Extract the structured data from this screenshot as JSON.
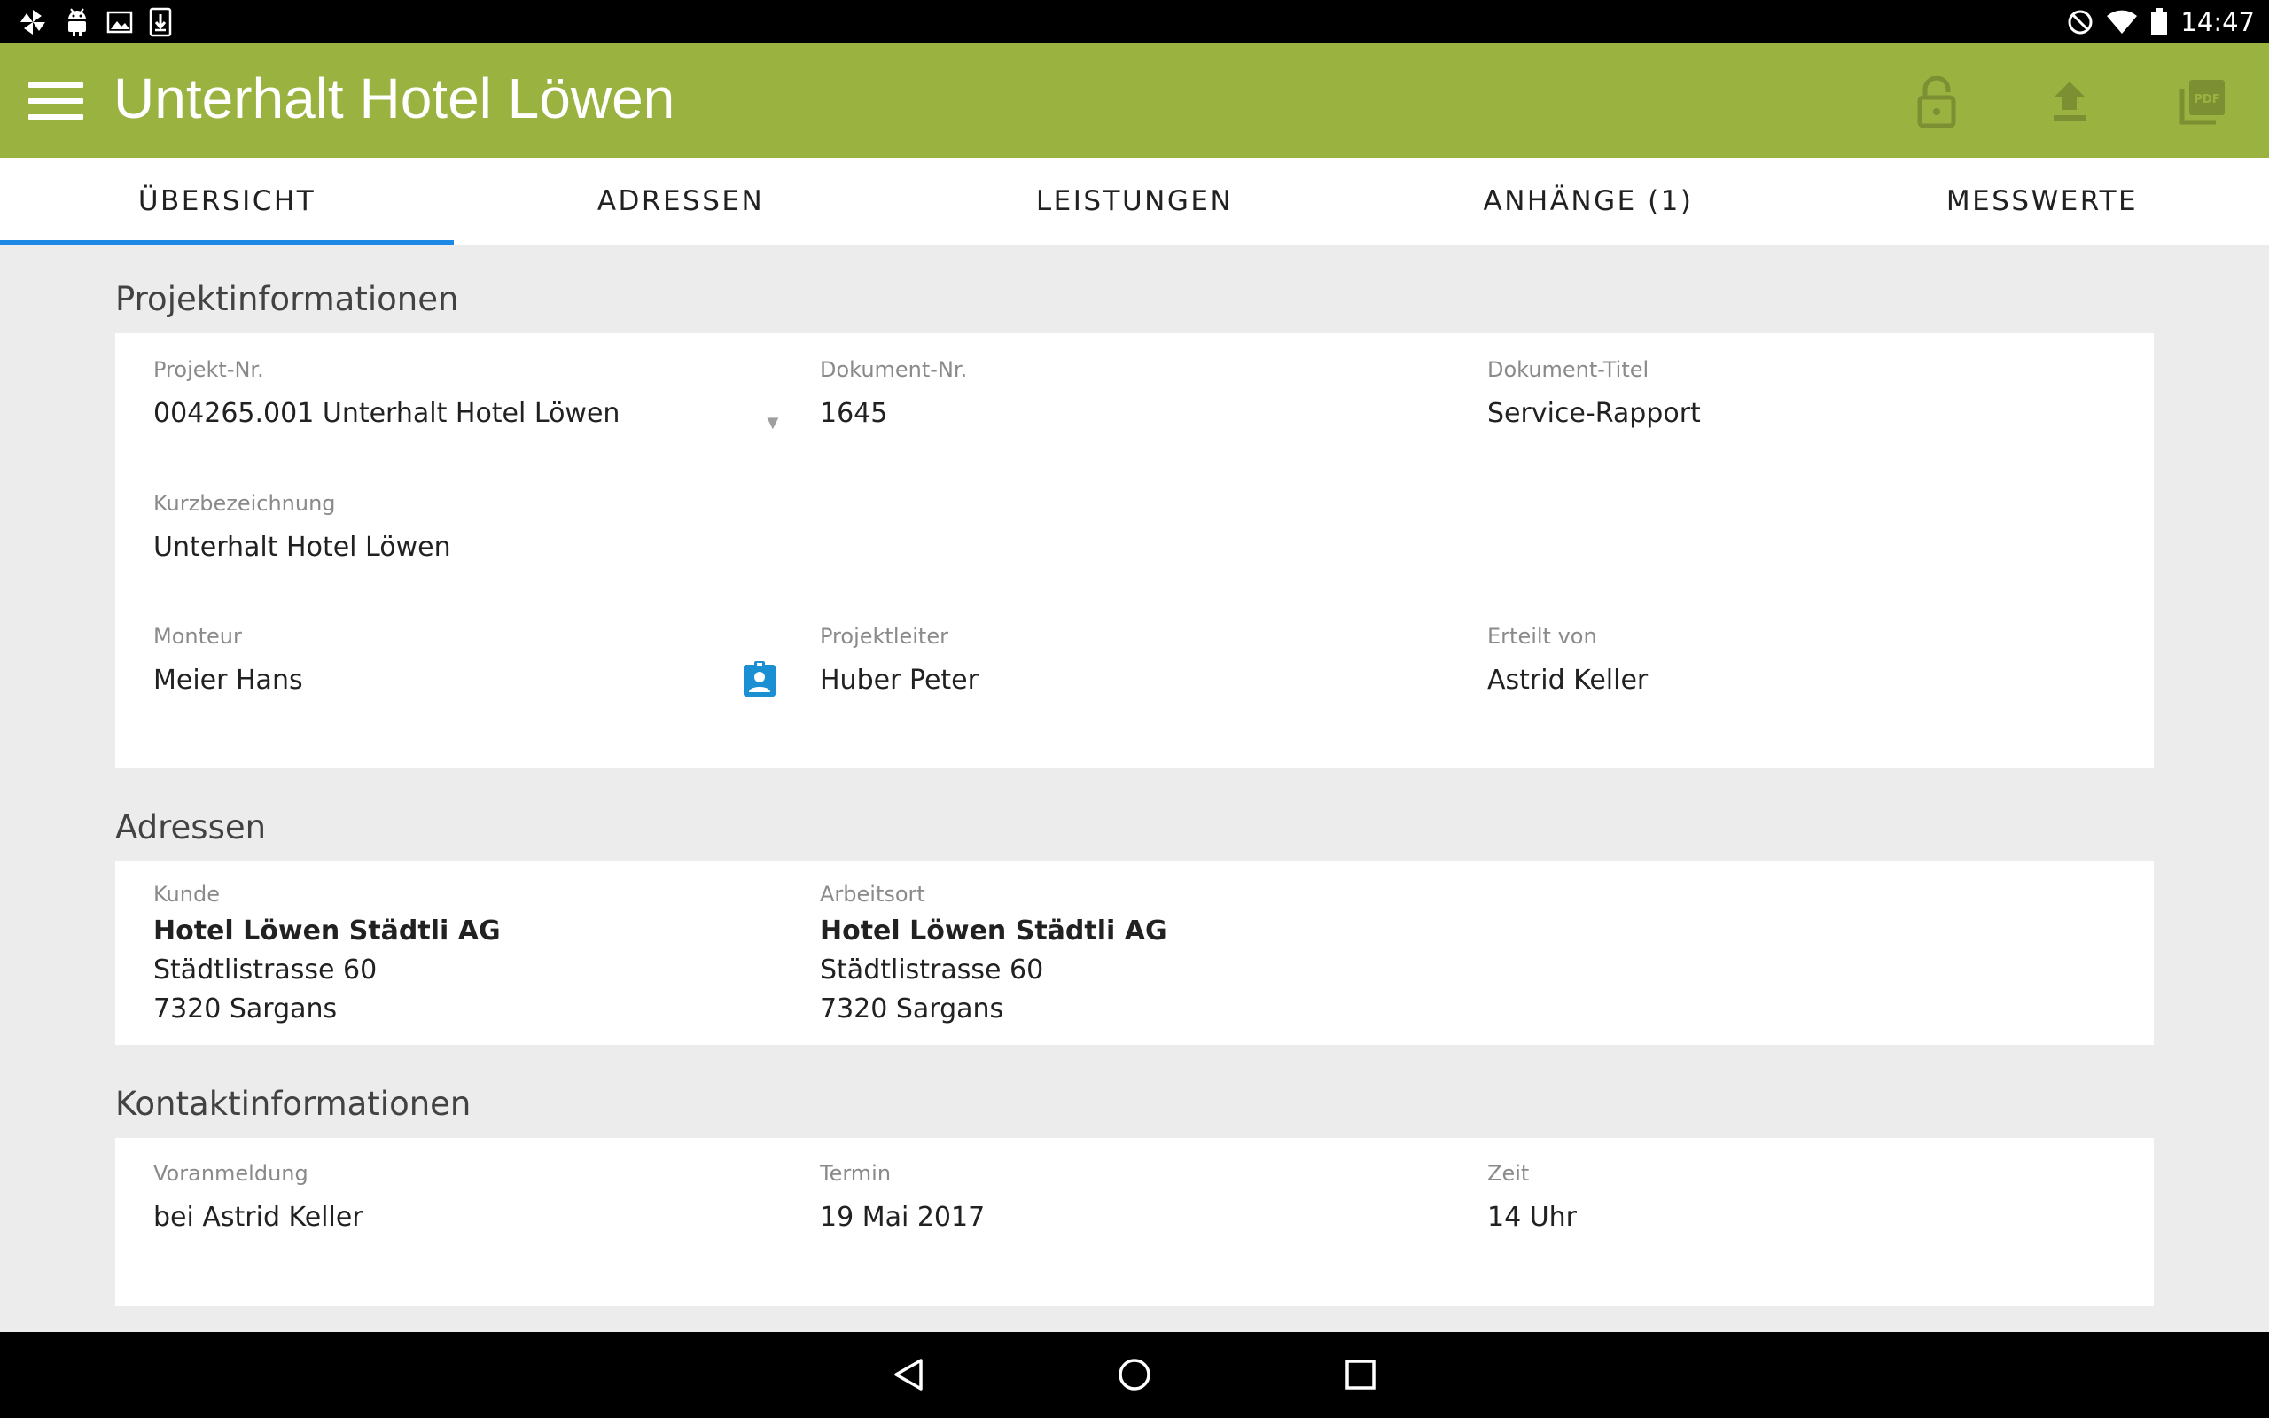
{
  "status_bar": {
    "time": "14:47",
    "left_icons": [
      "pinwheel-icon",
      "android-icon",
      "image-icon",
      "download-icon"
    ],
    "right_icons": [
      "do-not-disturb-icon",
      "wifi-icon",
      "battery-icon"
    ]
  },
  "app_bar": {
    "title": "Unterhalt Hotel Löwen",
    "background_color": "#9ab240",
    "actions": [
      "lock-open-icon",
      "upload-icon",
      "pdf-icon"
    ]
  },
  "tabs": [
    {
      "label": "ÜBERSICHT",
      "active": true
    },
    {
      "label": "ADRESSEN",
      "active": false
    },
    {
      "label": "LEISTUNGEN",
      "active": false
    },
    {
      "label": "ANHÄNGE (1)",
      "active": false
    },
    {
      "label": "MESSWERTE",
      "active": false
    }
  ],
  "accent_color": "#1e88e5",
  "projekt": {
    "section_title": "Projektinformationen",
    "projekt_nr": {
      "label": "Projekt-Nr.",
      "value": "004265.001 Unterhalt Hotel Löwen"
    },
    "dokument_nr": {
      "label": "Dokument-Nr.",
      "value": "1645"
    },
    "dokument_titel": {
      "label": "Dokument-Titel",
      "value": "Service-Rapport"
    },
    "kurzbezeichnung": {
      "label": "Kurzbezeichnung",
      "value": "Unterhalt Hotel Löwen"
    },
    "monteur": {
      "label": "Monteur",
      "value": "Meier Hans"
    },
    "projektleiter": {
      "label": "Projektleiter",
      "value": "Huber Peter"
    },
    "erteilt_von": {
      "label": "Erteilt von",
      "value": "Astrid Keller"
    }
  },
  "adressen": {
    "section_title": "Adressen",
    "kunde": {
      "label": "Kunde",
      "name": "Hotel Löwen Städtli AG",
      "street": "Städtlistrasse 60",
      "city": "7320 Sargans"
    },
    "arbeitsort": {
      "label": "Arbeitsort",
      "name": "Hotel Löwen Städtli AG",
      "street": "Städtlistrasse 60",
      "city": "7320 Sargans"
    }
  },
  "kontakt": {
    "section_title": "Kontaktinformationen",
    "voranmeldung": {
      "label": "Voranmeldung",
      "value": "bei Astrid Keller"
    },
    "termin": {
      "label": "Termin",
      "value": "19 Mai 2017"
    },
    "zeit": {
      "label": "Zeit",
      "value": "14 Uhr"
    }
  },
  "nav_bar": {
    "buttons": [
      "back-icon",
      "home-icon",
      "recents-icon"
    ]
  }
}
